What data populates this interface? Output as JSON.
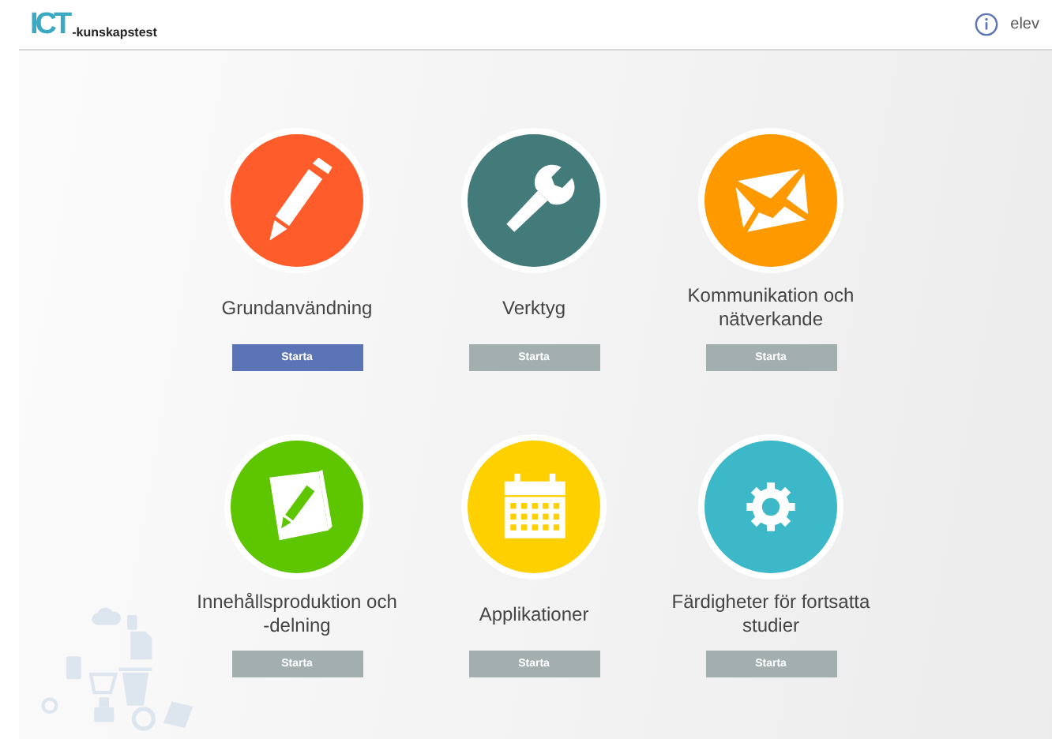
{
  "header": {
    "logo_mark": "ICT",
    "logo_text": "-kunskapstest",
    "user": "elev"
  },
  "tiles": [
    {
      "title": "Grundanvändning",
      "kind": "pencil",
      "color": "#ff5c2b",
      "button": "Starta",
      "disabled": false
    },
    {
      "title": "Verktyg",
      "kind": "wrench",
      "color": "#437b7b",
      "button": "Starta",
      "disabled": true
    },
    {
      "title": "Kommunikation och nätverkande",
      "kind": "envelope",
      "color": "#ff9900",
      "button": "Starta",
      "disabled": true
    },
    {
      "title": "Innehållsproduktion och -delning",
      "kind": "notebook",
      "color": "#5ec600",
      "button": "Starta",
      "disabled": true
    },
    {
      "title": "Applikationer",
      "kind": "calendar",
      "color": "#ffd000",
      "button": "Starta",
      "disabled": true
    },
    {
      "title": "Färdigheter för fortsatta studier",
      "kind": "gear",
      "color": "#3db8c9",
      "button": "Starta",
      "disabled": true
    }
  ]
}
